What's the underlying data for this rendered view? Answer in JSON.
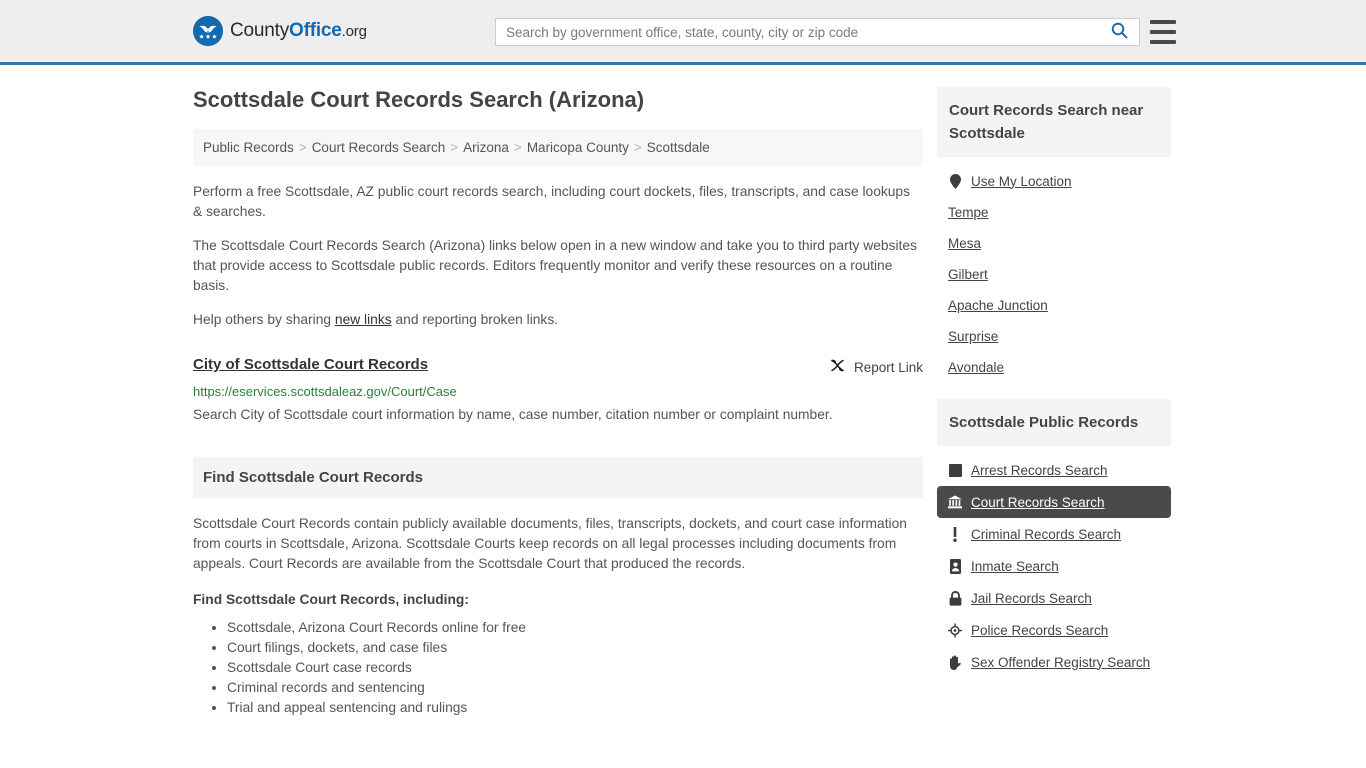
{
  "header": {
    "logo": {
      "icon": "eagle-shield-logo-icon",
      "part1": "County",
      "part2": "Office",
      "part3": ".org"
    },
    "search": {
      "placeholder": "Search by government office, state, county, city or zip code",
      "value": "",
      "search_icon": "search-icon"
    },
    "menu_icon": "hamburger-menu-icon"
  },
  "page_title": "Scottsdale Court Records Search (Arizona)",
  "breadcrumb": {
    "separator": ">",
    "items": [
      {
        "label": "Public Records"
      },
      {
        "label": "Court Records Search"
      },
      {
        "label": "Arizona"
      },
      {
        "label": "Maricopa County"
      },
      {
        "label": "Scottsdale"
      }
    ]
  },
  "intro": {
    "p1": "Perform a free Scottsdale, AZ public court records search, including court dockets, files, transcripts, and case lookups & searches.",
    "p2": "The Scottsdale Court Records Search (Arizona) links below open in a new window and take you to third party websites that provide access to Scottsdale public records. Editors frequently monitor and verify these resources on a routine basis.",
    "p3_before": "Help others by sharing ",
    "p3_link": "new links",
    "p3_after": " and reporting broken links."
  },
  "result": {
    "title": "City of Scottsdale Court Records",
    "url": "https://eservices.scottsdaleaz.gov/Court/Case",
    "description": "Search City of Scottsdale court information by name, case number, citation number or complaint number.",
    "report_label": "Report Link",
    "report_icon": "broken-link-icon"
  },
  "find_section": {
    "heading": "Find Scottsdale Court Records",
    "body": "Scottsdale Court Records contain publicly available documents, files, transcripts, dockets, and court case information from courts in Scottsdale, Arizona. Scottsdale Courts keep records on all legal processes including documents from appeals. Court Records are available from the Scottsdale Court that produced the records.",
    "list_heading": "Find Scottsdale Court Records, including:",
    "bullets": [
      "Scottsdale, Arizona Court Records online for free",
      "Court filings, dockets, and case files",
      "Scottsdale Court case records",
      "Criminal records and sentencing",
      "Trial and appeal sentencing and rulings"
    ]
  },
  "sidebar": {
    "nearby": {
      "heading": "Court Records Search near Scottsdale",
      "items": [
        {
          "label": "Use My Location",
          "icon": "map-pin-icon"
        },
        {
          "label": "Tempe",
          "icon": ""
        },
        {
          "label": "Mesa",
          "icon": ""
        },
        {
          "label": "Gilbert",
          "icon": ""
        },
        {
          "label": "Apache Junction",
          "icon": ""
        },
        {
          "label": "Surprise",
          "icon": ""
        },
        {
          "label": "Avondale",
          "icon": ""
        }
      ]
    },
    "public_records": {
      "heading": "Scottsdale Public Records",
      "items": [
        {
          "label": "Arrest Records Search",
          "icon": "fingerprint-card-icon",
          "active": false
        },
        {
          "label": "Court Records Search",
          "icon": "courthouse-icon",
          "active": true
        },
        {
          "label": "Criminal Records Search",
          "icon": "exclamation-icon",
          "active": false
        },
        {
          "label": "Inmate Search",
          "icon": "id-badge-icon",
          "active": false
        },
        {
          "label": "Jail Records Search",
          "icon": "padlock-icon",
          "active": false
        },
        {
          "label": "Police Records Search",
          "icon": "police-badge-icon",
          "active": false
        },
        {
          "label": "Sex Offender Registry Search",
          "icon": "hand-icon",
          "active": false
        }
      ]
    }
  },
  "colors": {
    "brand_blue": "#1569b0",
    "header_border": "#3a76a8",
    "header_bg": "#eeeeee",
    "panel_bg": "#f4f4f4",
    "breadcrumb_bg": "#f7f7f7",
    "url_green": "#2a7d3f",
    "active_bg": "#4a4a4a",
    "text": "#555555"
  }
}
